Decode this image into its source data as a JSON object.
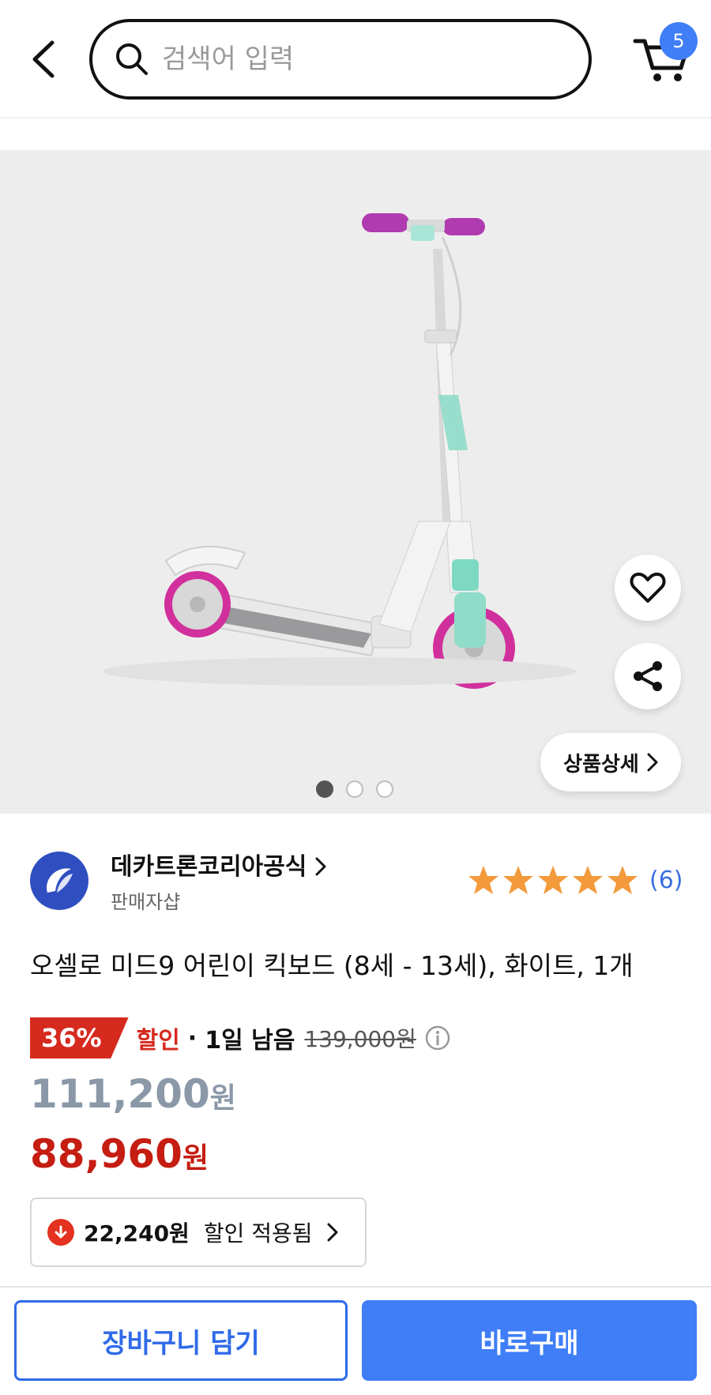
{
  "header": {
    "search_placeholder": "검색어 입력",
    "cart_count": "5"
  },
  "hero": {
    "detail_button_label": "상품상세",
    "image_count": 3,
    "active_image": 1
  },
  "seller": {
    "name": "데카트론코리아공식",
    "type": "판매자샵",
    "rating": 5,
    "review_count": "(6)"
  },
  "product": {
    "title": "오셀로 미드9 어린이 킥보드 (8세 - 13세), 화이트, 1개"
  },
  "price": {
    "discount_percent": "36%",
    "discount_label": "할인",
    "separator": "·",
    "time_left": "1일 남음",
    "original_price": "139,000원",
    "sale_price_number": "111,200",
    "sale_price_unit": "원",
    "final_price_number": "88,960",
    "final_price_unit": "원"
  },
  "coupon": {
    "amount": "22,240원",
    "text": "할인 적용됨"
  },
  "actions": {
    "add_to_cart_label": "장바구니 담기",
    "buy_now_label": "바로구매"
  },
  "colors": {
    "accent_blue": "#3f7ef7",
    "discount_red": "#d62a1f",
    "star_orange": "#f39a3c"
  }
}
